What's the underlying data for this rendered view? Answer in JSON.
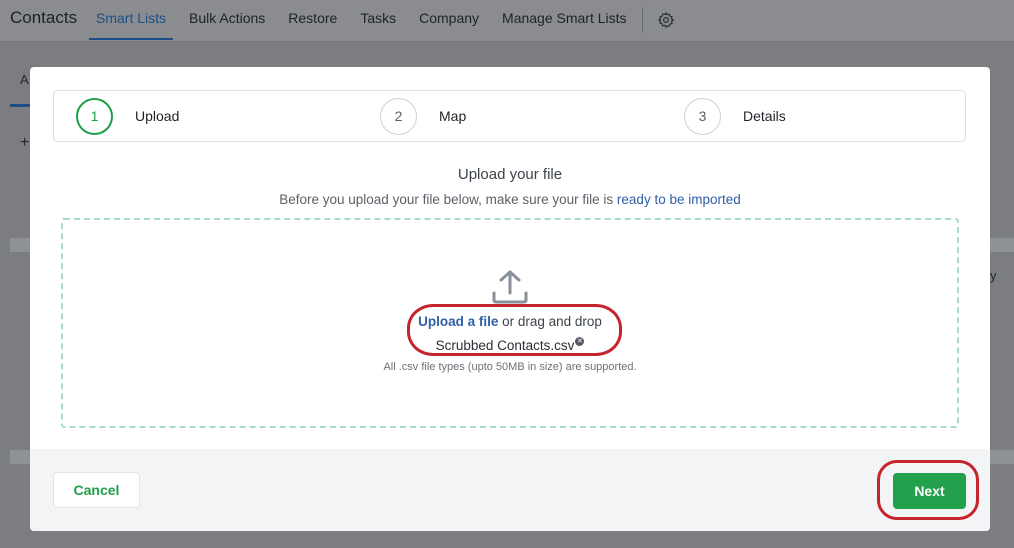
{
  "app": {
    "title": "Contacts",
    "nav": [
      "Smart Lists",
      "Bulk Actions",
      "Restore",
      "Tasks",
      "Company",
      "Manage Smart Lists"
    ],
    "active_nav": "Smart Lists",
    "settings_icon": "gear-icon",
    "bg_tab_fragment": "A",
    "bg_plus": "+",
    "bg_right_fragment": "y"
  },
  "modal": {
    "steps": [
      {
        "number": "1",
        "label": "Upload",
        "active": true
      },
      {
        "number": "2",
        "label": "Map",
        "active": false
      },
      {
        "number": "3",
        "label": "Details",
        "active": false
      }
    ],
    "upload_title": "Upload your file",
    "upload_subtitle_prefix": "Before you upload your file below, make sure your file is ",
    "upload_subtitle_link": "ready to be imported",
    "upload_icon": "upload-arrow-icon",
    "upload_link": "Upload a file",
    "upload_or_drag": " or drag and drop",
    "selected_file": "Scrubbed Contacts.csv",
    "remove_file_icon": "remove-file-icon",
    "hint": "All .csv file types (upto 50MB in size) are supported.",
    "cancel_label": "Cancel",
    "next_label": "Next"
  },
  "colors": {
    "accent_green": "#23a04b",
    "link_blue": "#2e5fa8",
    "annotation_red": "#c6242b"
  }
}
